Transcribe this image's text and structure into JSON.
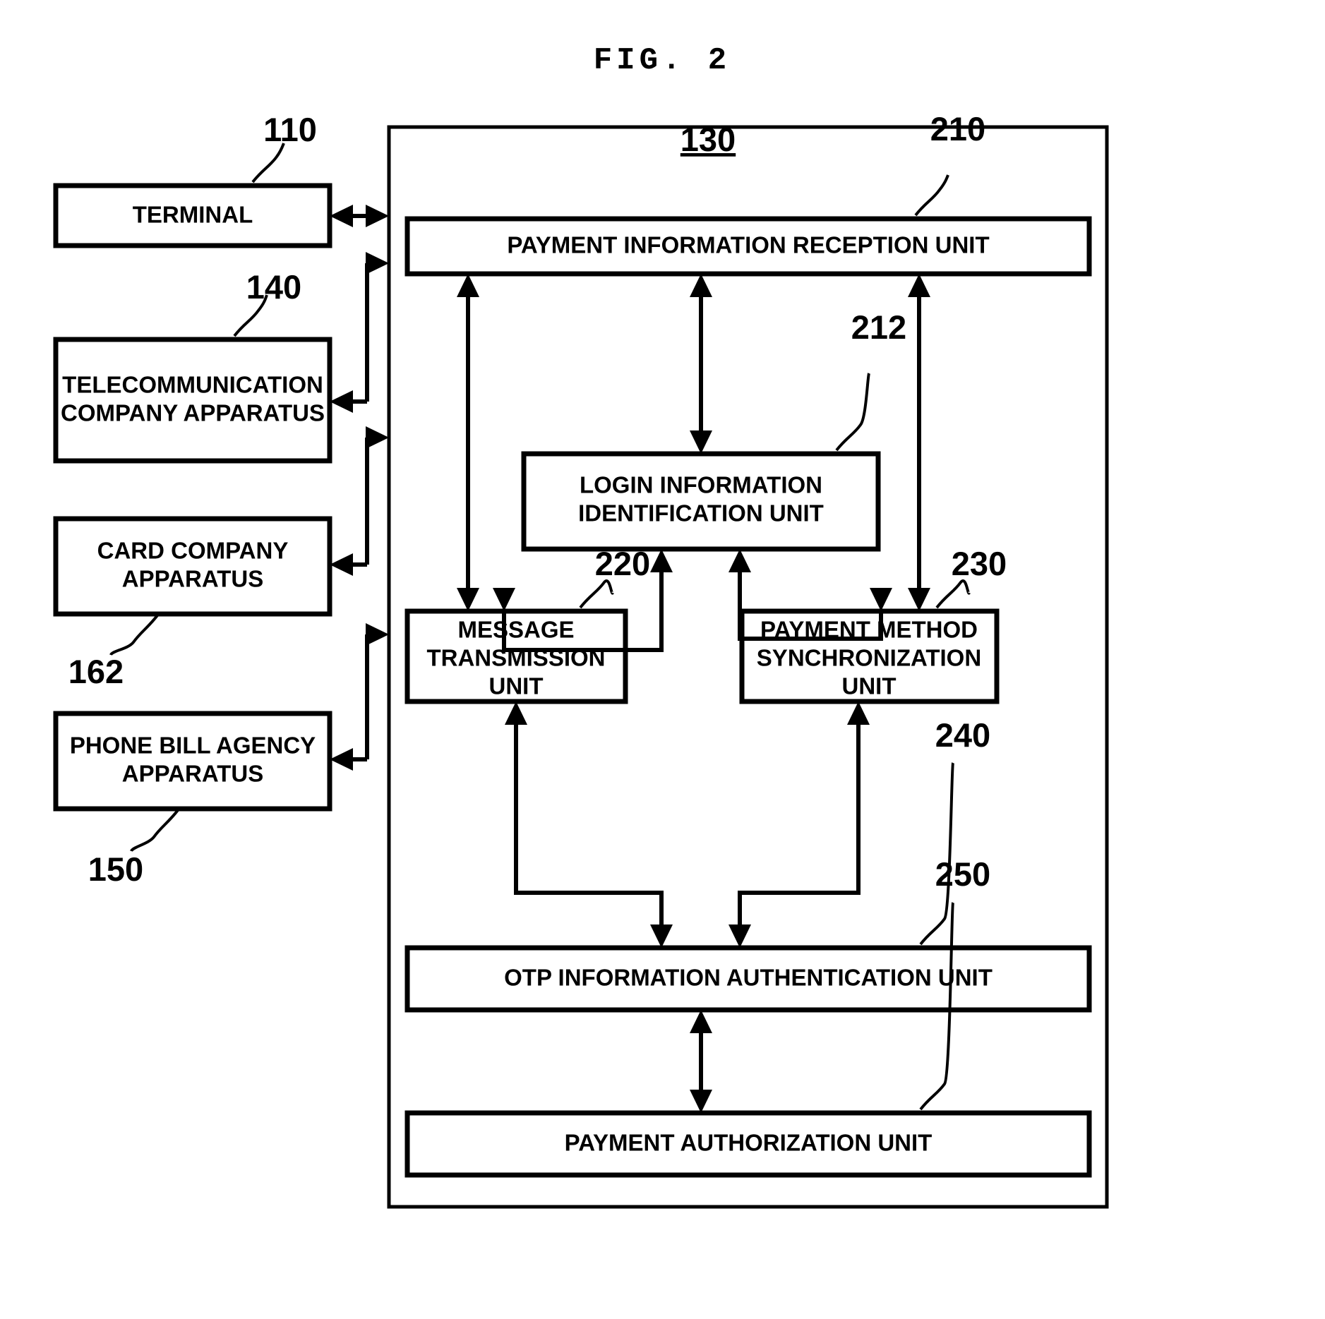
{
  "figure": {
    "title": "FIG. 2",
    "type": "patent-block-diagram"
  },
  "external_blocks": [
    {
      "id": "terminal",
      "label": "TERMINAL",
      "ref": "110",
      "lines": [
        "TERMINAL"
      ]
    },
    {
      "id": "telecom",
      "label": "TELECOMMUNICATION COMPANY APPARATUS",
      "ref": "140",
      "lines": [
        "TELECOMMUNICATION",
        "COMPANY APPARATUS"
      ]
    },
    {
      "id": "card-company",
      "label": "CARD COMPANY APPARATUS",
      "ref": "162",
      "lines": [
        "CARD COMPANY",
        "APPARATUS"
      ]
    },
    {
      "id": "phone-bill",
      "label": "PHONE BILL AGENCY APPARATUS",
      "ref": "150",
      "lines": [
        "PHONE BILL AGENCY",
        "APPARATUS"
      ]
    }
  ],
  "container": {
    "ref": "130",
    "ref_underlined": true
  },
  "internal_blocks": [
    {
      "id": "reception",
      "label": "PAYMENT INFORMATION RECEPTION UNIT",
      "ref": "210",
      "lines": [
        "PAYMENT INFORMATION RECEPTION UNIT"
      ]
    },
    {
      "id": "login",
      "label": "LOGIN INFORMATION IDENTIFICATION UNIT",
      "ref": "212",
      "lines": [
        "LOGIN INFORMATION",
        "IDENTIFICATION UNIT"
      ]
    },
    {
      "id": "message",
      "label": "MESSAGE TRANSMISSION UNIT",
      "ref": "220",
      "lines": [
        "MESSAGE",
        "TRANSMISSION",
        "UNIT"
      ]
    },
    {
      "id": "sync",
      "label": "PAYMENT METHOD SYNCHRONIZATION UNIT",
      "ref": "230",
      "lines": [
        "PAYMENT METHOD",
        "SYNCHRONIZATION",
        "UNIT"
      ]
    },
    {
      "id": "otp",
      "label": "OTP INFORMATION AUTHENTICATION UNIT",
      "ref": "240",
      "lines": [
        "OTP INFORMATION AUTHENTICATION UNIT"
      ]
    },
    {
      "id": "authorization",
      "label": "PAYMENT AUTHORIZATION UNIT",
      "ref": "250",
      "lines": [
        "PAYMENT AUTHORIZATION UNIT"
      ]
    }
  ],
  "reference_numerals": {
    "terminal": "110",
    "container": "130",
    "telecom": "140",
    "phone_bill": "150",
    "card_company": "162",
    "reception": "210",
    "login": "212",
    "message": "220",
    "sync": "230",
    "otp": "240",
    "authorization": "250"
  },
  "colors": {
    "line": "#000000",
    "fill": "#ffffff"
  }
}
